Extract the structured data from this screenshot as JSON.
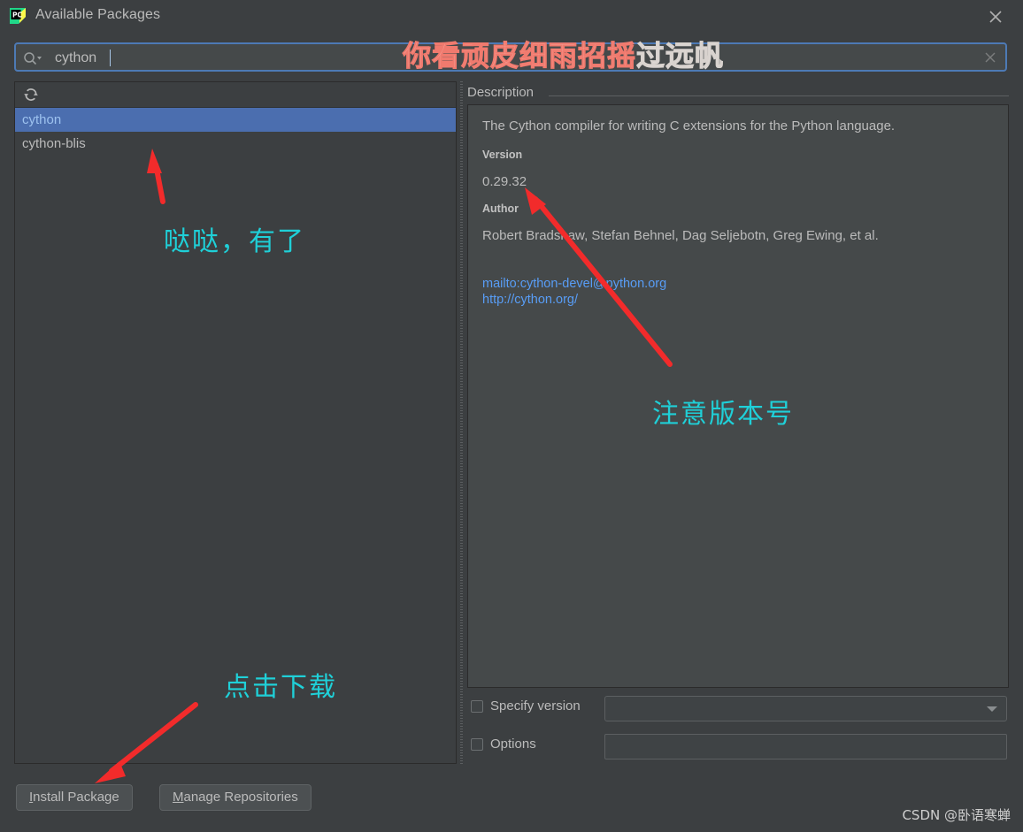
{
  "window": {
    "title": "Available Packages",
    "app_icon": "pycharm-logo-icon",
    "close_icon": "close-icon"
  },
  "search": {
    "icon": "search-icon",
    "value": "cython",
    "placeholder": "",
    "clear_icon": "clear-icon"
  },
  "list_panel": {
    "refresh_icon": "refresh-icon",
    "items": [
      {
        "name": "cython",
        "selected": true
      },
      {
        "name": "cython-blis",
        "selected": false
      }
    ]
  },
  "description": {
    "legend": "Description",
    "summary": "The Cython compiler for writing C extensions for the Python language.",
    "version_label": "Version",
    "version_value": "0.29.32",
    "author_label": "Author",
    "author_value": "Robert Bradshaw, Stefan Behnel, Dag Seljebotn, Greg Ewing, et al.",
    "links": [
      "mailto:cython-devel@python.org",
      "http://cython.org/"
    ]
  },
  "options": {
    "specify_version_label": "Specify version",
    "specify_version_checked": false,
    "specify_version_value": "",
    "options_label": "Options",
    "options_checked": false,
    "options_value": ""
  },
  "footer": {
    "install_mnemonic": "I",
    "install_rest": "nstall Package",
    "repos_mnemonic": "M",
    "repos_rest": "anage Repositories"
  },
  "annotations": {
    "top_pink": "你看顽皮细雨招摇",
    "top_pale": "过远帆",
    "found_it": "哒哒，有了",
    "note_version": "注意版本号",
    "click_download": "点击下载"
  },
  "watermark": "CSDN @卧语寒蝉",
  "colors": {
    "accent_blue": "#4b6eaf",
    "selection_text": "#9dc2ef",
    "link_blue": "#589df6",
    "annotation_cyan": "#1fd0d8",
    "arrow_red": "#f22b2b",
    "panel_bg": "#3c3f41",
    "field_bg": "#45494a"
  }
}
